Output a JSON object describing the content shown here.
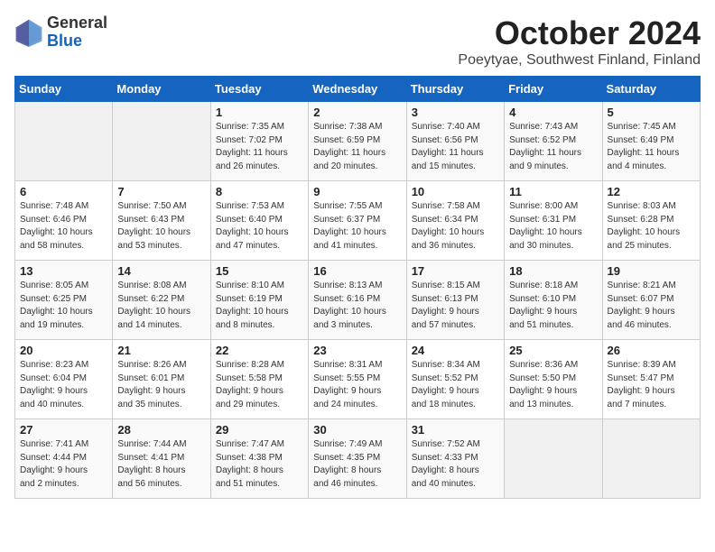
{
  "logo": {
    "general": "General",
    "blue": "Blue"
  },
  "title": "October 2024",
  "location": "Poeytyae, Southwest Finland, Finland",
  "days_header": [
    "Sunday",
    "Monday",
    "Tuesday",
    "Wednesday",
    "Thursday",
    "Friday",
    "Saturday"
  ],
  "weeks": [
    [
      {
        "day": "",
        "info": ""
      },
      {
        "day": "",
        "info": ""
      },
      {
        "day": "1",
        "info": "Sunrise: 7:35 AM\nSunset: 7:02 PM\nDaylight: 11 hours\nand 26 minutes."
      },
      {
        "day": "2",
        "info": "Sunrise: 7:38 AM\nSunset: 6:59 PM\nDaylight: 11 hours\nand 20 minutes."
      },
      {
        "day": "3",
        "info": "Sunrise: 7:40 AM\nSunset: 6:56 PM\nDaylight: 11 hours\nand 15 minutes."
      },
      {
        "day": "4",
        "info": "Sunrise: 7:43 AM\nSunset: 6:52 PM\nDaylight: 11 hours\nand 9 minutes."
      },
      {
        "day": "5",
        "info": "Sunrise: 7:45 AM\nSunset: 6:49 PM\nDaylight: 11 hours\nand 4 minutes."
      }
    ],
    [
      {
        "day": "6",
        "info": "Sunrise: 7:48 AM\nSunset: 6:46 PM\nDaylight: 10 hours\nand 58 minutes."
      },
      {
        "day": "7",
        "info": "Sunrise: 7:50 AM\nSunset: 6:43 PM\nDaylight: 10 hours\nand 53 minutes."
      },
      {
        "day": "8",
        "info": "Sunrise: 7:53 AM\nSunset: 6:40 PM\nDaylight: 10 hours\nand 47 minutes."
      },
      {
        "day": "9",
        "info": "Sunrise: 7:55 AM\nSunset: 6:37 PM\nDaylight: 10 hours\nand 41 minutes."
      },
      {
        "day": "10",
        "info": "Sunrise: 7:58 AM\nSunset: 6:34 PM\nDaylight: 10 hours\nand 36 minutes."
      },
      {
        "day": "11",
        "info": "Sunrise: 8:00 AM\nSunset: 6:31 PM\nDaylight: 10 hours\nand 30 minutes."
      },
      {
        "day": "12",
        "info": "Sunrise: 8:03 AM\nSunset: 6:28 PM\nDaylight: 10 hours\nand 25 minutes."
      }
    ],
    [
      {
        "day": "13",
        "info": "Sunrise: 8:05 AM\nSunset: 6:25 PM\nDaylight: 10 hours\nand 19 minutes."
      },
      {
        "day": "14",
        "info": "Sunrise: 8:08 AM\nSunset: 6:22 PM\nDaylight: 10 hours\nand 14 minutes."
      },
      {
        "day": "15",
        "info": "Sunrise: 8:10 AM\nSunset: 6:19 PM\nDaylight: 10 hours\nand 8 minutes."
      },
      {
        "day": "16",
        "info": "Sunrise: 8:13 AM\nSunset: 6:16 PM\nDaylight: 10 hours\nand 3 minutes."
      },
      {
        "day": "17",
        "info": "Sunrise: 8:15 AM\nSunset: 6:13 PM\nDaylight: 9 hours\nand 57 minutes."
      },
      {
        "day": "18",
        "info": "Sunrise: 8:18 AM\nSunset: 6:10 PM\nDaylight: 9 hours\nand 51 minutes."
      },
      {
        "day": "19",
        "info": "Sunrise: 8:21 AM\nSunset: 6:07 PM\nDaylight: 9 hours\nand 46 minutes."
      }
    ],
    [
      {
        "day": "20",
        "info": "Sunrise: 8:23 AM\nSunset: 6:04 PM\nDaylight: 9 hours\nand 40 minutes."
      },
      {
        "day": "21",
        "info": "Sunrise: 8:26 AM\nSunset: 6:01 PM\nDaylight: 9 hours\nand 35 minutes."
      },
      {
        "day": "22",
        "info": "Sunrise: 8:28 AM\nSunset: 5:58 PM\nDaylight: 9 hours\nand 29 minutes."
      },
      {
        "day": "23",
        "info": "Sunrise: 8:31 AM\nSunset: 5:55 PM\nDaylight: 9 hours\nand 24 minutes."
      },
      {
        "day": "24",
        "info": "Sunrise: 8:34 AM\nSunset: 5:52 PM\nDaylight: 9 hours\nand 18 minutes."
      },
      {
        "day": "25",
        "info": "Sunrise: 8:36 AM\nSunset: 5:50 PM\nDaylight: 9 hours\nand 13 minutes."
      },
      {
        "day": "26",
        "info": "Sunrise: 8:39 AM\nSunset: 5:47 PM\nDaylight: 9 hours\nand 7 minutes."
      }
    ],
    [
      {
        "day": "27",
        "info": "Sunrise: 7:41 AM\nSunset: 4:44 PM\nDaylight: 9 hours\nand 2 minutes."
      },
      {
        "day": "28",
        "info": "Sunrise: 7:44 AM\nSunset: 4:41 PM\nDaylight: 8 hours\nand 56 minutes."
      },
      {
        "day": "29",
        "info": "Sunrise: 7:47 AM\nSunset: 4:38 PM\nDaylight: 8 hours\nand 51 minutes."
      },
      {
        "day": "30",
        "info": "Sunrise: 7:49 AM\nSunset: 4:35 PM\nDaylight: 8 hours\nand 46 minutes."
      },
      {
        "day": "31",
        "info": "Sunrise: 7:52 AM\nSunset: 4:33 PM\nDaylight: 8 hours\nand 40 minutes."
      },
      {
        "day": "",
        "info": ""
      },
      {
        "day": "",
        "info": ""
      }
    ]
  ]
}
